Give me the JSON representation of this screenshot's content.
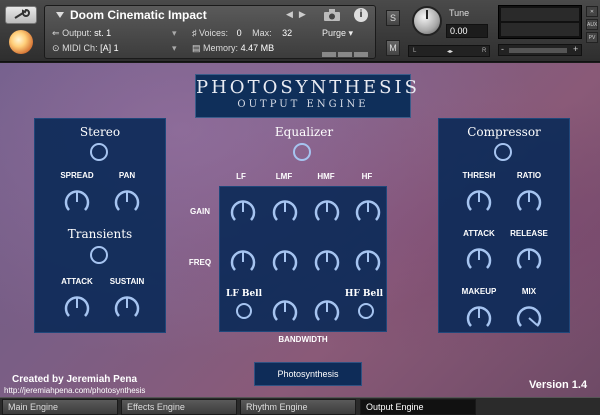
{
  "header": {
    "instrument_name": "Doom Cinematic Impact",
    "output_label": "Output:",
    "output_value": "st. 1",
    "voices_label": "Voices:",
    "voices_value": "0",
    "max_label": "Max:",
    "max_value": "32",
    "midi_label": "MIDI Ch:",
    "midi_value": "[A]  1",
    "memory_label": "Memory:",
    "memory_value": "4.47 MB",
    "purge_label": "Purge",
    "info_label": "i",
    "solo_label": "S",
    "mute_label": "M",
    "tune_label": "Tune",
    "tune_value": "0.00",
    "pan_left": "L",
    "pan_right": "R",
    "vol_minus": "-",
    "vol_plus": "+",
    "side_buttons": [
      "",
      "AUX",
      "PV"
    ]
  },
  "plugin": {
    "title": "PHOTOSYNTHESIS",
    "subtitle": "OUTPUT ENGINE",
    "stereo": {
      "title": "Stereo",
      "spread_label": "SPREAD",
      "pan_label": "PAN"
    },
    "transients": {
      "title": "Transients",
      "attack_label": "ATTACK",
      "sustain_label": "SUSTAIN"
    },
    "equalizer": {
      "title": "Equalizer",
      "bands": [
        "LF",
        "LMF",
        "HMF",
        "HF"
      ],
      "gain_label": "GAIN",
      "freq_label": "FREQ",
      "lf_bell_label": "LF Bell",
      "hf_bell_label": "HF Bell",
      "bandwidth_label": "BANDWIDTH"
    },
    "compressor": {
      "title": "Compressor",
      "thresh_label": "THRESH",
      "ratio_label": "RATIO",
      "attack_label": "ATTACK",
      "release_label": "RELEASE",
      "makeup_label": "MAKEUP",
      "mix_label": "MIX"
    },
    "credit": "Created by Jeremiah Pena",
    "credit_url": "http://jeremiahpena.com/photosynthesis",
    "preset_name": "Photosynthesis",
    "version": "Version 1.4"
  },
  "tabs": [
    {
      "label": "Main Engine",
      "active": false
    },
    {
      "label": "Effects Engine",
      "active": false
    },
    {
      "label": "Rhythm Engine",
      "active": false
    },
    {
      "label": "Output Engine",
      "active": true
    }
  ]
}
